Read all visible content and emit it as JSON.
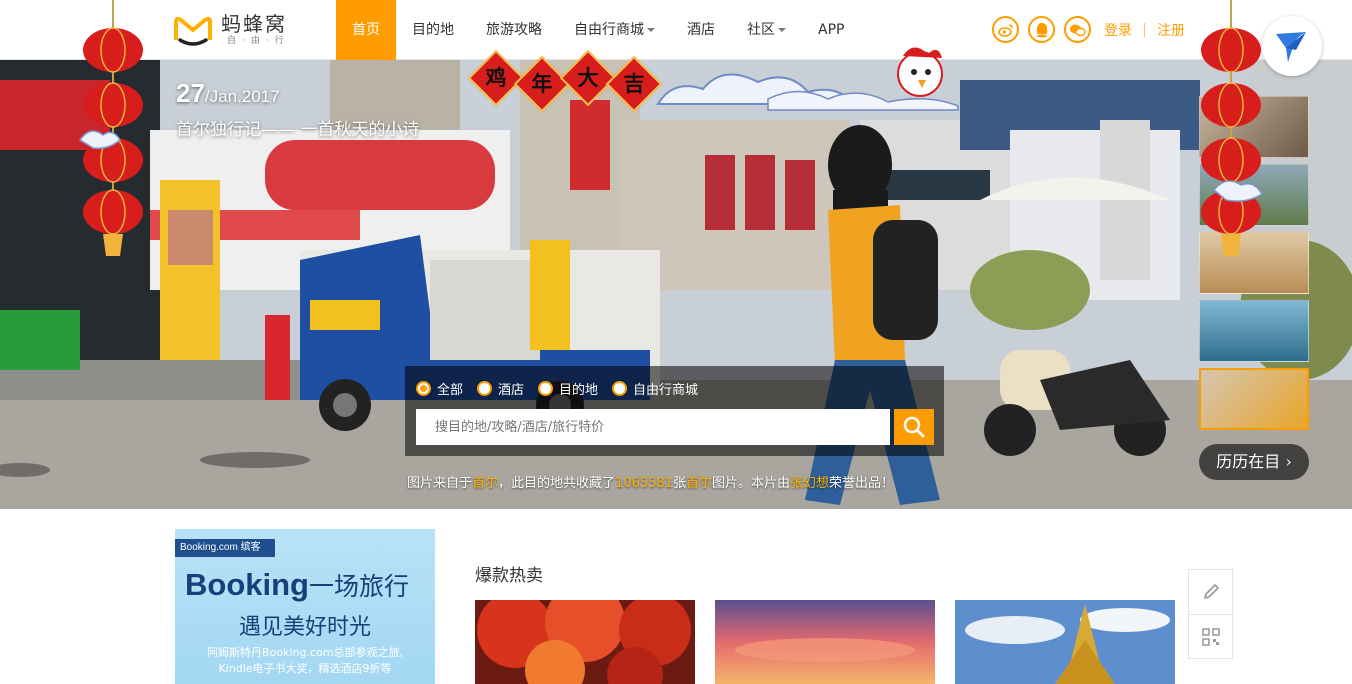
{
  "brand": {
    "name": "蚂蜂窝",
    "tagline": "自·由·行"
  },
  "nav": [
    {
      "label": "首页",
      "active": true,
      "dropdown": false
    },
    {
      "label": "目的地",
      "dropdown": false
    },
    {
      "label": "旅游攻略",
      "dropdown": false
    },
    {
      "label": "自由行商城",
      "dropdown": true
    },
    {
      "label": "酒店",
      "dropdown": false
    },
    {
      "label": "社区",
      "dropdown": true
    },
    {
      "label": "APP",
      "dropdown": false
    }
  ],
  "social": [
    "weibo-icon",
    "qq-icon",
    "wechat-icon"
  ],
  "auth": {
    "login": "登录",
    "register": "注册"
  },
  "festive": {
    "banner_chars": [
      "鸡",
      "年",
      "大",
      "吉"
    ]
  },
  "hero": {
    "day": "27",
    "month_year": "/Jan.2017",
    "headline": "首尔独行记—— 一首秋天的小诗",
    "search": {
      "options": [
        {
          "label": "全部",
          "checked": true
        },
        {
          "label": "酒店",
          "checked": false
        },
        {
          "label": "目的地",
          "checked": false
        },
        {
          "label": "自由行商城",
          "checked": false
        }
      ],
      "placeholder": "搜目的地/攻略/酒店/旅行特价"
    },
    "caption": {
      "p1": "图片来自于",
      "place1": "首尔",
      "p2": "，此目的地共收藏了",
      "count": "1065581",
      "p3": "张",
      "place2": "首尔",
      "p4": "图片。本片由",
      "author": "张幻想",
      "p5": "荣誉出品！"
    },
    "thumbnail_count": 5,
    "active_thumbnail": 5,
    "calendar_label": "历历在目 ›"
  },
  "ad": {
    "tag": "Booking.com 缤客",
    "brand_en": "Booking",
    "brand_cn": "一场旅行",
    "subtitle": "遇见美好时光",
    "fine_line1": "阿姆斯特丹Booking.com总部参观之旅,",
    "fine_line2": "Kindle电子书大奖，精选酒店9折等"
  },
  "hot": {
    "title": "爆款热卖"
  },
  "side_tools": [
    "edit-icon",
    "qrcode-icon"
  ],
  "colors": {
    "accent": "#ff9d00",
    "lantern": "#d81d1d",
    "ad_blue": "#173f7a"
  }
}
